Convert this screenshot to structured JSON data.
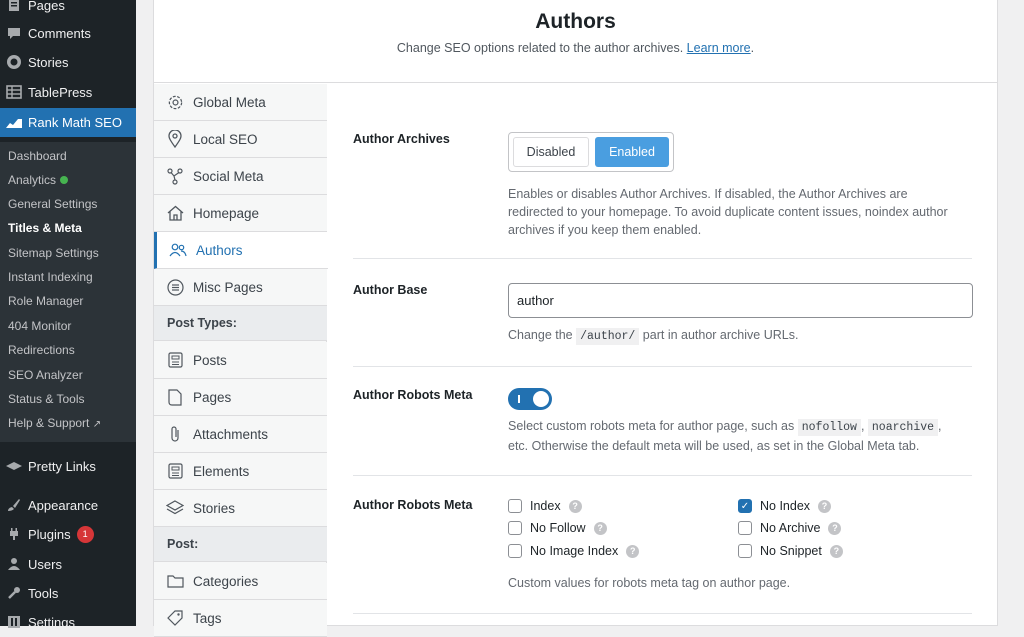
{
  "sidebar": {
    "items": [
      {
        "label": "Pages",
        "icon": "pages-icon"
      },
      {
        "label": "Comments",
        "icon": "comments-icon"
      },
      {
        "label": "Stories",
        "icon": "stories-icon"
      },
      {
        "label": "TablePress",
        "icon": "table-icon"
      },
      {
        "label": "Rank Math SEO",
        "icon": "rank-math-icon"
      }
    ],
    "submenu": [
      {
        "label": "Dashboard"
      },
      {
        "label": "Analytics"
      },
      {
        "label": "General Settings"
      },
      {
        "label": "Titles & Meta"
      },
      {
        "label": "Sitemap Settings"
      },
      {
        "label": "Instant Indexing"
      },
      {
        "label": "Role Manager"
      },
      {
        "label": "404 Monitor"
      },
      {
        "label": "Redirections"
      },
      {
        "label": "SEO Analyzer"
      },
      {
        "label": "Status & Tools"
      },
      {
        "label": "Help & Support"
      }
    ],
    "lower_items": [
      {
        "label": "Pretty Links"
      },
      {
        "label": "Appearance"
      },
      {
        "label": "Plugins",
        "badge": "1"
      },
      {
        "label": "Users"
      },
      {
        "label": "Tools"
      },
      {
        "label": "Settings"
      }
    ]
  },
  "header": {
    "title": "Authors",
    "description": "Change SEO options related to the author archives. ",
    "learn_more": "Learn more",
    "period": "."
  },
  "tabs": {
    "global_meta": "Global Meta",
    "local_seo": "Local SEO",
    "social_meta": "Social Meta",
    "homepage": "Homepage",
    "authors": "Authors",
    "misc_pages": "Misc Pages",
    "post_types_heading": "Post Types:",
    "posts": "Posts",
    "pages": "Pages",
    "attachments": "Attachments",
    "elements": "Elements",
    "stories": "Stories",
    "post_heading": "Post:",
    "categories": "Categories",
    "tags": "Tags"
  },
  "settings": {
    "author_archives": {
      "label": "Author Archives",
      "disabled": "Disabled",
      "enabled": "Enabled",
      "desc_line1": "Enables or disables Author Archives. If disabled, the Author Archives are",
      "desc_line2": "redirected to your homepage. To avoid duplicate content issues, noindex author",
      "desc_line3": "archives if you keep them enabled."
    },
    "author_base": {
      "label": "Author Base",
      "value": "author",
      "desc_pre": "Change the ",
      "desc_code": "/author/",
      "desc_post": " part in author archive URLs."
    },
    "author_robots_meta_toggle": {
      "label": "Author Robots Meta",
      "desc_pre": "Select custom robots meta for author page, such as ",
      "code1": "nofollow",
      "sep": ", ",
      "code2": "noarchive",
      "desc_after": ",",
      "desc_line2": "etc. Otherwise the default meta will be used, as set in the Global Meta tab."
    },
    "author_robots_meta": {
      "label": "Author Robots Meta",
      "options": {
        "index": "Index",
        "no_index": "No Index",
        "no_follow": "No Follow",
        "no_archive": "No Archive",
        "no_image_index": "No Image Index",
        "no_snippet": "No Snippet"
      },
      "checked_mark": "✓",
      "help": "?",
      "desc": "Custom values for robots meta tag on author page."
    }
  }
}
